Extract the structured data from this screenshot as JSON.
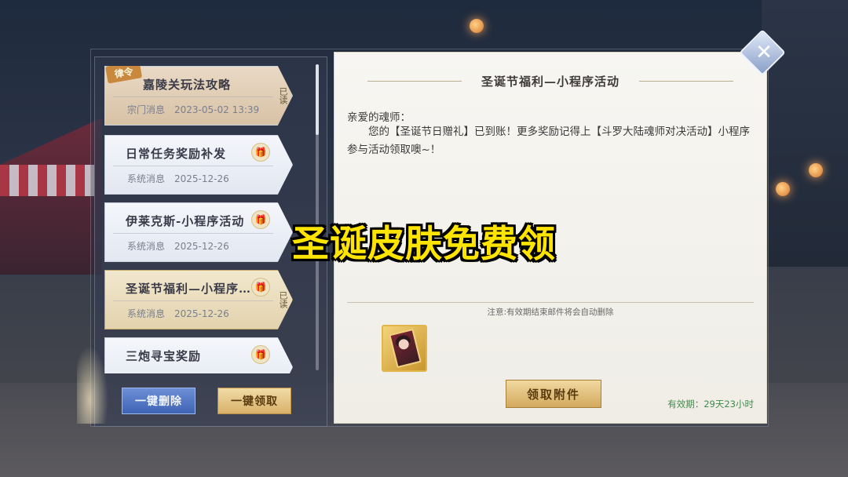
{
  "mail_list": [
    {
      "title": "嘉陵关玩法攻略",
      "category": "宗门消息",
      "date": "2023-05-02 13:39",
      "read_label": "已读",
      "pinned": true,
      "pin_label": "律令",
      "has_gift": false
    },
    {
      "title": "日常任务奖励补发",
      "category": "系统消息",
      "date": "2025-12-26",
      "has_gift": true
    },
    {
      "title": "伊莱克斯-小程序活动",
      "category": "系统消息",
      "date": "2025-12-26",
      "has_gift": true
    },
    {
      "title": "圣诞节福利—小程序…",
      "category": "系统消息",
      "date": "2025-12-26",
      "read_label": "已读",
      "has_gift": true,
      "selected": true
    },
    {
      "title": "三炮寻宝奖励",
      "has_gift": true
    }
  ],
  "actions": {
    "delete_all": "一键删除",
    "claim_all": "一键领取"
  },
  "detail": {
    "title": "圣诞节福利—小程序活动",
    "greeting": "亲爱的魂师：",
    "body": "您的【圣诞节日赠礼】已到账！更多奖励记得上【斗罗大陆魂师对决活动】小程序参与活动领取噢~！",
    "notice": "注意:有效期结束邮件将会自动删除",
    "claim_attachment": "领取附件",
    "expiry": "有效期：29天23小时"
  },
  "close_icon": "close-icon",
  "overlay_caption": "圣诞皮肤免费领",
  "colors": {
    "caption": "#ffe400",
    "delete_button": "#3f63b4",
    "claim_button": "#d8b16a",
    "expiry_text": "#3f8b4a"
  }
}
